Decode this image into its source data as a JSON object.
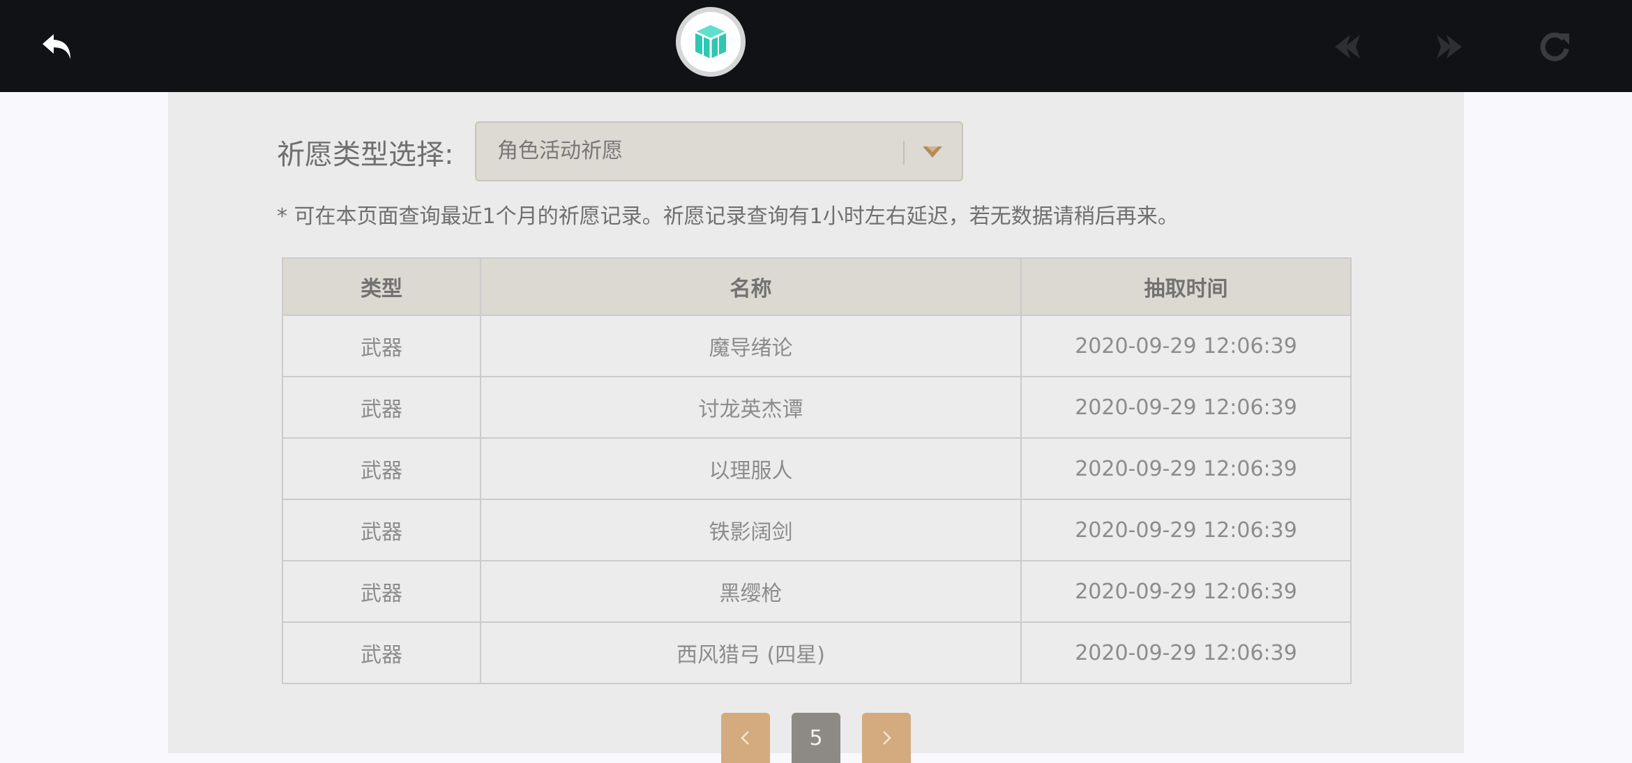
{
  "topbar": {
    "icons": [
      "back-arrow-icon",
      "app-logo-icon",
      "nav-prev-icon",
      "nav-next-icon",
      "reload-icon"
    ],
    "logo_color": "#2ec7b0"
  },
  "filter": {
    "label": "祈愿类型选择:",
    "selected": "角色活动祈愿"
  },
  "notice": "* 可在本页面查询最近1个月的祈愿记录。祈愿记录查询有1小时左右延迟，若无数据请稍后再来。",
  "table": {
    "headers": [
      "类型",
      "名称",
      "抽取时间"
    ],
    "rows": [
      {
        "type": "武器",
        "name": "魔导绪论",
        "time": "2020-09-29 12:06:39"
      },
      {
        "type": "武器",
        "name": "讨龙英杰谭",
        "time": "2020-09-29 12:06:39"
      },
      {
        "type": "武器",
        "name": "以理服人",
        "time": "2020-09-29 12:06:39"
      },
      {
        "type": "武器",
        "name": "铁影阔剑",
        "time": "2020-09-29 12:06:39"
      },
      {
        "type": "武器",
        "name": "黑缨枪",
        "time": "2020-09-29 12:06:39"
      },
      {
        "type": "武器",
        "name": "西风猎弓 (四星)",
        "time": "2020-09-29 12:06:39"
      }
    ]
  },
  "pagination": {
    "current_page": "5"
  },
  "colors": {
    "topbar": "#111215",
    "panel": "#ebebeb",
    "accent_button": "#d4ab7e",
    "four_star_text": "#a45fc9"
  }
}
